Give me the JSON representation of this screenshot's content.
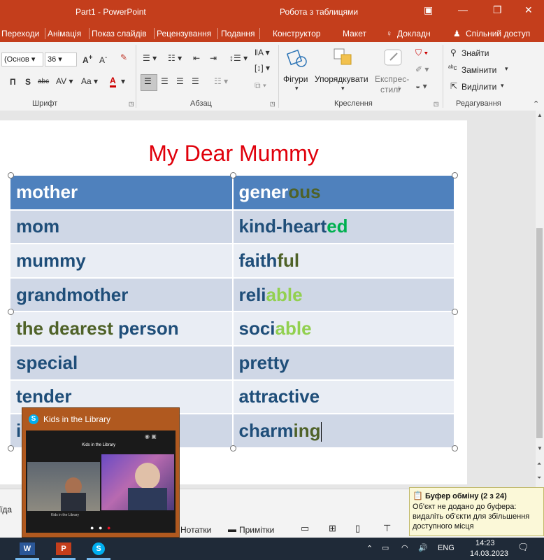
{
  "window": {
    "title": "Part1 - PowerPoint",
    "context_title": "Робота з таблицями"
  },
  "tabs": [
    "Переходи",
    "Анімація",
    "Показ слайдів",
    "Рецензування",
    "Подання",
    "Конструктор",
    "Макет"
  ],
  "tell_me": "Докладн",
  "share": "Спільний доступ",
  "ribbon": {
    "font_name": "(Основ",
    "font_size": "36",
    "groups": {
      "font": "Шрифт",
      "paragraph": "Абзац",
      "drawing": "Креслення",
      "editing": "Редагування"
    },
    "drawing": {
      "shapes": "Фігури",
      "arrange": "Упорядкувати",
      "express_line1": "Експрес-",
      "express_line2": "стилі"
    },
    "editing": {
      "find": "Знайти",
      "replace": "Замінити",
      "select": "Виділити"
    }
  },
  "slide": {
    "title": "My Dear Mummy",
    "title_color": "#e0000b",
    "rows": [
      {
        "left": "mother",
        "right_base": "gener",
        "right_suffix": "ous"
      },
      {
        "left": "mom",
        "right_base": "kind-heart",
        "right_suffix": "ed"
      },
      {
        "left": "mummy",
        "right_base": "faith",
        "right_suffix": "ful"
      },
      {
        "left": "grandmother",
        "right_base": "reli",
        "right_suffix": "able"
      },
      {
        "left_a": "the dear",
        "left_b": "est",
        "left_c": " person",
        "right_base": "soci",
        "right_suffix": "able"
      },
      {
        "left": "special",
        "right": "pretty"
      },
      {
        "left": "tender",
        "right": "attractive"
      },
      {
        "left": "i",
        "right_a": "charm",
        "right_b": "ing"
      }
    ]
  },
  "skype": {
    "title": "Kids in the Library",
    "call_title": "Kids in the Library",
    "tile_label": "Kids in the Library"
  },
  "statusbar": {
    "left_text": "ïда",
    "notes": "Нотатки",
    "comments": "Примітки"
  },
  "clipboard": {
    "title": "Буфер обміну (2 з 24)",
    "message": "Об'єкт не додано до буфера: видаліть об'єкти для збільшення доступного місця"
  },
  "taskbar": {
    "lang": "ENG",
    "time": "14:23",
    "date": "14.03.2023"
  },
  "colors": {
    "accent": "#c43e1c",
    "table_header": "#4f81bd",
    "table_text": "#1f4e79"
  }
}
